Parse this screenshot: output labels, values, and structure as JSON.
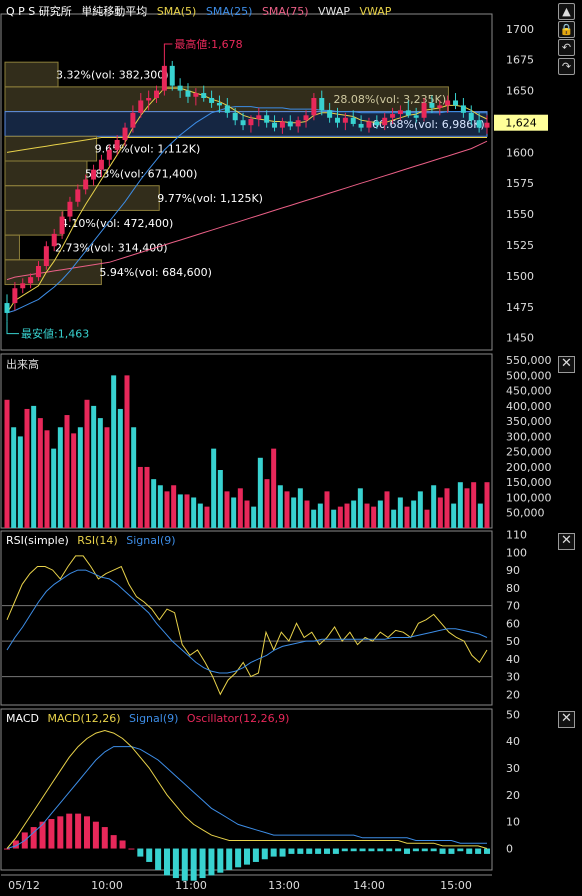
{
  "header": {
    "stock_name": "Q P S 研究所",
    "chart_type": "単純移動平均",
    "indicators": [
      {
        "label": "SMA(5)",
        "color": "#e8d24a"
      },
      {
        "label": "SMA(25)",
        "color": "#3d8de6"
      },
      {
        "label": "SMA(75)",
        "color": "#ea5f86"
      },
      {
        "label": "VWAP",
        "color": "#e6e6e6"
      },
      {
        "label": "VWAP",
        "color": "#e8d24a"
      }
    ]
  },
  "side_buttons": [
    {
      "icon": "up-icon",
      "glyph": "▲"
    },
    {
      "icon": "lock-icon",
      "glyph": "🔒"
    },
    {
      "icon": "undo-icon",
      "glyph": "↶"
    },
    {
      "icon": "redo-icon",
      "glyph": "↷"
    }
  ],
  "colors": {
    "up": "#e8285a",
    "down": "#38d2d0",
    "sma5": "#e8d24a",
    "sma25": "#3d8de6",
    "sma75": "#ea5f86",
    "macd": "#e8d24a",
    "signal": "#3d8de6",
    "grid": "#3a3a3a",
    "axis_text": "#dddddd",
    "last_price_bg": "#ffff99"
  },
  "chart_data": [
    {
      "type": "candlestick",
      "yticks": [
        1450,
        1475,
        1500,
        1525,
        1550,
        1575,
        1600,
        1625,
        1650,
        1675,
        1700
      ],
      "ylim": [
        1440,
        1712
      ],
      "last_price": "1,624",
      "last_price_value": 1624,
      "high_label": "最高値:1,678",
      "high_value": 1678,
      "low_label": "最安値:1,463",
      "low_value": 1463,
      "ohlc": [
        [
          1478,
          1485,
          1463,
          1470
        ],
        [
          1478,
          1495,
          1472,
          1490
        ],
        [
          1490,
          1498,
          1486,
          1494
        ],
        [
          1494,
          1502,
          1490,
          1499
        ],
        [
          1499,
          1512,
          1496,
          1508
        ],
        [
          1508,
          1528,
          1505,
          1524
        ],
        [
          1524,
          1538,
          1520,
          1534
        ],
        [
          1534,
          1552,
          1530,
          1548
        ],
        [
          1548,
          1564,
          1544,
          1560
        ],
        [
          1560,
          1574,
          1556,
          1570
        ],
        [
          1570,
          1582,
          1566,
          1578
        ],
        [
          1578,
          1590,
          1573,
          1586
        ],
        [
          1586,
          1598,
          1580,
          1594
        ],
        [
          1594,
          1606,
          1589,
          1602
        ],
        [
          1602,
          1614,
          1598,
          1610
        ],
        [
          1610,
          1624,
          1605,
          1620
        ],
        [
          1620,
          1638,
          1616,
          1632
        ],
        [
          1632,
          1648,
          1628,
          1642
        ],
        [
          1642,
          1650,
          1634,
          1644
        ],
        [
          1644,
          1654,
          1640,
          1650
        ],
        [
          1650,
          1678,
          1646,
          1670
        ],
        [
          1670,
          1674,
          1650,
          1654
        ],
        [
          1654,
          1660,
          1644,
          1650
        ],
        [
          1650,
          1656,
          1640,
          1645
        ],
        [
          1645,
          1652,
          1638,
          1648
        ],
        [
          1648,
          1654,
          1641,
          1644
        ],
        [
          1644,
          1650,
          1636,
          1640
        ],
        [
          1640,
          1646,
          1632,
          1638
        ],
        [
          1638,
          1644,
          1628,
          1632
        ],
        [
          1632,
          1636,
          1622,
          1626
        ],
        [
          1626,
          1632,
          1618,
          1622
        ],
        [
          1622,
          1630,
          1616,
          1627
        ],
        [
          1627,
          1636,
          1621,
          1630
        ],
        [
          1630,
          1634,
          1620,
          1624
        ],
        [
          1624,
          1630,
          1617,
          1620
        ],
        [
          1620,
          1628,
          1615,
          1625
        ],
        [
          1625,
          1630,
          1618,
          1621
        ],
        [
          1621,
          1629,
          1616,
          1626
        ],
        [
          1626,
          1634,
          1620,
          1630
        ],
        [
          1630,
          1648,
          1626,
          1644
        ],
        [
          1644,
          1650,
          1630,
          1634
        ],
        [
          1634,
          1640,
          1624,
          1628
        ],
        [
          1628,
          1636,
          1620,
          1624
        ],
        [
          1624,
          1632,
          1618,
          1628
        ],
        [
          1628,
          1634,
          1621,
          1623
        ],
        [
          1623,
          1630,
          1617,
          1620
        ],
        [
          1620,
          1628,
          1616,
          1625
        ],
        [
          1625,
          1630,
          1619,
          1622
        ],
        [
          1622,
          1632,
          1618,
          1628
        ],
        [
          1628,
          1636,
          1623,
          1631
        ],
        [
          1631,
          1638,
          1626,
          1634
        ],
        [
          1634,
          1642,
          1628,
          1630
        ],
        [
          1630,
          1636,
          1624,
          1628
        ],
        [
          1628,
          1644,
          1625,
          1640
        ],
        [
          1640,
          1646,
          1632,
          1636
        ],
        [
          1636,
          1642,
          1630,
          1638
        ],
        [
          1638,
          1646,
          1632,
          1642
        ],
        [
          1642,
          1648,
          1635,
          1638
        ],
        [
          1638,
          1644,
          1628,
          1632
        ],
        [
          1632,
          1638,
          1622,
          1626
        ],
        [
          1626,
          1632,
          1616,
          1620
        ],
        [
          1620,
          1630,
          1615,
          1624
        ]
      ],
      "sma5": [
        1470,
        1480,
        1484,
        1488,
        1492,
        1503,
        1512,
        1523,
        1535,
        1547,
        1558,
        1568,
        1578,
        1588,
        1598,
        1608,
        1620,
        1630,
        1638,
        1645,
        1652,
        1652,
        1652,
        1650,
        1648,
        1646,
        1643,
        1641,
        1638,
        1634,
        1630,
        1628,
        1627,
        1626,
        1625,
        1625,
        1624,
        1624,
        1625,
        1630,
        1632,
        1632,
        1631,
        1630,
        1629,
        1626,
        1625,
        1624,
        1624,
        1626,
        1628,
        1630,
        1631,
        1634,
        1635,
        1636,
        1638,
        1638,
        1637,
        1634,
        1630,
        1627
      ],
      "sma25": [
        1470,
        1472,
        1475,
        1478,
        1481,
        1486,
        1491,
        1497,
        1504,
        1512,
        1520,
        1528,
        1536,
        1544,
        1552,
        1560,
        1569,
        1578,
        1586,
        1594,
        1602,
        1608,
        1614,
        1619,
        1624,
        1628,
        1632,
        1634,
        1636,
        1637,
        1637,
        1637,
        1636,
        1636,
        1636,
        1636,
        1635,
        1635,
        1635,
        1635,
        1634,
        1634,
        1633,
        1633,
        1633,
        1632,
        1632,
        1632,
        1632,
        1632,
        1632,
        1632,
        1632,
        1632,
        1632,
        1632,
        1633,
        1633,
        1633,
        1633,
        1632,
        1632
      ],
      "sma75": [
        1497,
        1499,
        1500,
        1501,
        1502,
        1503,
        1504,
        1505,
        1506,
        1507,
        1508,
        1509,
        1510,
        1511,
        1513,
        1515,
        1517,
        1519,
        1521,
        1523,
        1525,
        1527,
        1529,
        1531,
        1533,
        1535,
        1537,
        1539,
        1541,
        1543,
        1545,
        1547,
        1549,
        1551,
        1553,
        1555,
        1557,
        1559,
        1561,
        1563,
        1565,
        1567,
        1569,
        1571,
        1573,
        1575,
        1577,
        1579,
        1581,
        1583,
        1585,
        1587,
        1589,
        1591,
        1593,
        1595,
        1597,
        1599,
        1601,
        1603,
        1606,
        1609
      ],
      "vwap": [
        1600,
        1601,
        1602,
        1603,
        1604,
        1605,
        1606,
        1607,
        1608,
        1609,
        1610,
        1611,
        1612,
        1612,
        1612,
        1612,
        1612,
        1612,
        1612,
        1612,
        1612,
        1612,
        1612,
        1612,
        1612,
        1612,
        1612,
        1612,
        1612,
        1612,
        1612,
        1612,
        1612,
        1612,
        1612,
        1612,
        1612,
        1612,
        1612,
        1612,
        1612,
        1612,
        1612,
        1612,
        1612,
        1612,
        1612,
        1612,
        1612,
        1612,
        1612,
        1612,
        1612,
        1612,
        1612,
        1612,
        1612,
        1612,
        1612,
        1612,
        1612,
        1612
      ],
      "price_bands": [
        {
          "label": "3.32%(vol: 382,300)",
          "pmin": 1653,
          "pmax": 1673,
          "frac": 0.11
        },
        {
          "label": "28.08%(vol: 3,235K)",
          "pmin": 1633,
          "pmax": 1653,
          "frac": 0.92
        },
        {
          "label": "60.68%(vol: 6,986K)",
          "pmin": 1613,
          "pmax": 1633,
          "frac": 1.0
        },
        {
          "label": "9.65%(vol: 1,112K)",
          "pmin": 1593,
          "pmax": 1613,
          "frac": 0.19
        },
        {
          "label": "5.83%(vol: 671,400)",
          "pmin": 1573,
          "pmax": 1593,
          "frac": 0.17
        },
        {
          "label": "9.77%(vol: 1,125K)",
          "pmin": 1553,
          "pmax": 1573,
          "frac": 0.32
        },
        {
          "label": "4.10%(vol: 472,400)",
          "pmin": 1533,
          "pmax": 1553,
          "frac": 0.12
        },
        {
          "label": "2.73%(vol: 314,400)",
          "pmin": 1513,
          "pmax": 1533,
          "frac": 0.03
        },
        {
          "label": "5.94%(vol: 684,600)",
          "pmin": 1493,
          "pmax": 1513,
          "frac": 0.2
        }
      ]
    },
    {
      "type": "bar",
      "title": "出来高",
      "yticks": [
        50000,
        100000,
        150000,
        200000,
        250000,
        300000,
        350000,
        400000,
        450000,
        500000,
        550000
      ],
      "ylim": [
        0,
        570000
      ],
      "values": [
        420000,
        330000,
        300000,
        390000,
        400000,
        360000,
        320000,
        260000,
        330000,
        370000,
        310000,
        330000,
        420000,
        400000,
        360000,
        330000,
        500000,
        390000,
        500000,
        330000,
        200000,
        200000,
        160000,
        140000,
        120000,
        140000,
        110000,
        110000,
        100000,
        80000,
        70000,
        260000,
        190000,
        120000,
        100000,
        130000,
        90000,
        70000,
        230000,
        160000,
        260000,
        140000,
        120000,
        100000,
        130000,
        90000,
        60000,
        80000,
        120000,
        60000,
        70000,
        80000,
        90000,
        130000,
        80000,
        70000,
        90000,
        120000,
        60000,
        100000,
        70000,
        90000,
        120000,
        60000,
        140000,
        100000,
        130000,
        80000,
        150000,
        130000,
        150000,
        80000,
        150000
      ]
    },
    {
      "type": "line",
      "title": "RSI(simple)",
      "series": [
        {
          "name": "RSI(14)",
          "color": "#e8d24a",
          "values": [
            62,
            72,
            82,
            88,
            92,
            92,
            90,
            85,
            92,
            98,
            98,
            92,
            85,
            88,
            90,
            92,
            82,
            75,
            72,
            68,
            62,
            68,
            66,
            48,
            42,
            45,
            38,
            30,
            20,
            28,
            32,
            38,
            30,
            32,
            55,
            45,
            55,
            50,
            60,
            52,
            55,
            48,
            52,
            58,
            50,
            55,
            48,
            52,
            50,
            55,
            52,
            56,
            55,
            52,
            60,
            62,
            65,
            60,
            55,
            52,
            50,
            42,
            38,
            45
          ]
        },
        {
          "name": "Signal(9)",
          "color": "#3d8de6",
          "values": [
            45,
            52,
            58,
            65,
            72,
            78,
            82,
            85,
            88,
            90,
            90,
            88,
            86,
            85,
            82,
            78,
            74,
            70,
            66,
            60,
            55,
            50,
            46,
            42,
            38,
            35,
            33,
            32,
            32,
            33,
            35,
            38,
            40,
            42,
            45,
            47,
            48,
            49,
            50,
            50,
            51,
            51,
            51,
            51,
            51,
            51,
            51,
            51,
            51,
            52,
            52,
            52,
            53,
            54,
            55,
            56,
            57,
            57,
            56,
            55,
            54,
            52
          ]
        }
      ],
      "yticks": [
        20,
        30,
        40,
        50,
        60,
        70,
        80,
        90,
        100,
        110
      ],
      "ylim": [
        14,
        112
      ],
      "hlines": [
        30,
        50,
        70
      ]
    },
    {
      "type": "line",
      "title": "MACD",
      "series": [
        {
          "name": "MACD(12,26)",
          "color": "#e8d24a",
          "values": [
            0,
            4,
            9,
            14,
            19,
            24,
            29,
            34,
            38,
            41,
            43,
            44,
            43,
            41,
            38,
            34,
            30,
            25,
            20,
            16,
            12,
            9,
            7,
            5,
            4,
            3,
            3,
            3,
            3,
            3,
            3,
            3,
            3,
            3,
            3,
            3,
            3,
            3,
            3,
            3,
            3,
            3,
            3,
            3,
            3,
            2,
            2,
            2,
            2,
            1,
            1,
            1,
            1,
            1,
            0
          ]
        },
        {
          "name": "Signal(9)",
          "color": "#3d8de6",
          "values": [
            0,
            1,
            3,
            6,
            9,
            13,
            17,
            21,
            25,
            29,
            33,
            36,
            38,
            38,
            38,
            37,
            35,
            33,
            30,
            27,
            24,
            21,
            18,
            15,
            13,
            11,
            9,
            8,
            7,
            6,
            5,
            5,
            5,
            5,
            5,
            5,
            5,
            5,
            5,
            5,
            4,
            4,
            4,
            4,
            4,
            4,
            3,
            3,
            3,
            3,
            3,
            2,
            2,
            2,
            2
          ]
        },
        {
          "name": "Oscillator(12,26,9)",
          "color": "#e8285a",
          "values": [
            0,
            3,
            6,
            8,
            10,
            11,
            12,
            13,
            13,
            12,
            10,
            8,
            5,
            3,
            0,
            -3,
            -5,
            -8,
            -10,
            -11,
            -12,
            -12,
            -11,
            -10,
            -9,
            -8,
            -7,
            -6,
            -5,
            -4,
            -3,
            -3,
            -2,
            -2,
            -2,
            -2,
            -2,
            -2,
            -1,
            -1,
            -1,
            -1,
            -1,
            -1,
            -1,
            -2,
            -1,
            -1,
            -1,
            -2,
            -2,
            -1,
            -2,
            -2,
            -2
          ]
        }
      ],
      "yticks": [
        0,
        10,
        20,
        30,
        40,
        50
      ],
      "ylim": [
        -8,
        52
      ]
    }
  ],
  "x_axis": {
    "labels": [
      "05/12",
      "10:00",
      "11:00",
      "13:00",
      "14:00",
      "15:00"
    ]
  }
}
